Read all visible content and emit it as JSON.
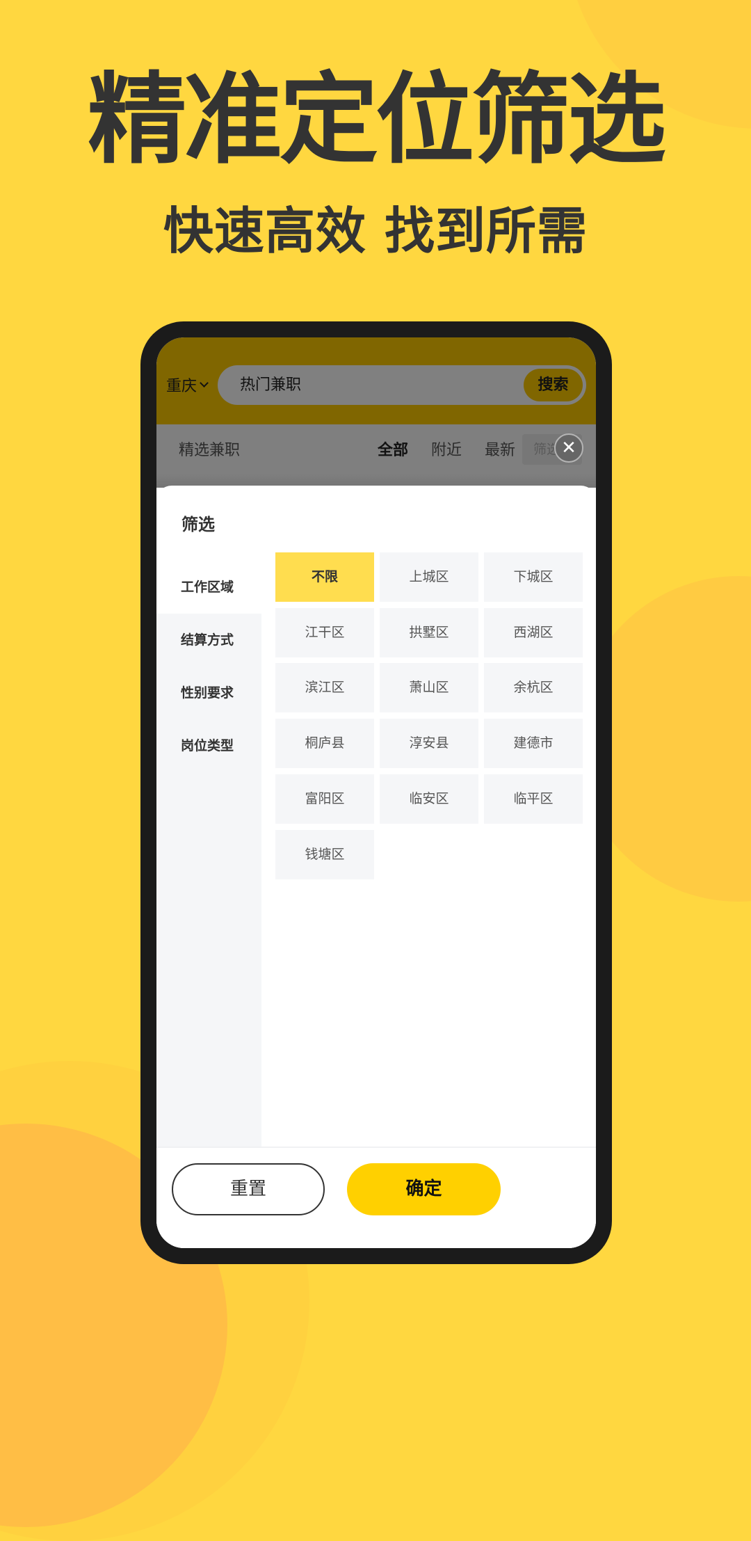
{
  "hero": {
    "title": "精准定位筛选",
    "subtitle": "快速高效 找到所需"
  },
  "app": {
    "city": "重庆",
    "search_text": "热门兼职",
    "search_button": "搜索",
    "section_title": "精选兼职",
    "tabs": [
      {
        "label": "全部",
        "active": true
      },
      {
        "label": "附近",
        "active": false
      },
      {
        "label": "最新",
        "active": false
      }
    ],
    "filter_chip": "筛选"
  },
  "filter_sheet": {
    "title": "筛选",
    "categories": [
      {
        "label": "工作区域",
        "active": true
      },
      {
        "label": "结算方式",
        "active": false
      },
      {
        "label": "性别要求",
        "active": false
      },
      {
        "label": "岗位类型",
        "active": false
      }
    ],
    "options": [
      {
        "label": "不限",
        "selected": true
      },
      {
        "label": "上城区",
        "selected": false
      },
      {
        "label": "下城区",
        "selected": false
      },
      {
        "label": "江干区",
        "selected": false
      },
      {
        "label": "拱墅区",
        "selected": false
      },
      {
        "label": "西湖区",
        "selected": false
      },
      {
        "label": "滨江区",
        "selected": false
      },
      {
        "label": "萧山区",
        "selected": false
      },
      {
        "label": "余杭区",
        "selected": false
      },
      {
        "label": "桐庐县",
        "selected": false
      },
      {
        "label": "淳安县",
        "selected": false
      },
      {
        "label": "建德市",
        "selected": false
      },
      {
        "label": "富阳区",
        "selected": false
      },
      {
        "label": "临安区",
        "selected": false
      },
      {
        "label": "临平区",
        "selected": false
      },
      {
        "label": "钱塘区",
        "selected": false
      }
    ],
    "reset_label": "重置",
    "confirm_label": "确定"
  },
  "icons": {
    "close": "✕",
    "city_dropdown": "chevron-down-icon"
  },
  "colors": {
    "background": "#ffd740",
    "accent": "#ffd000",
    "selected_option": "#ffdd4f",
    "text_dark": "#333333"
  }
}
